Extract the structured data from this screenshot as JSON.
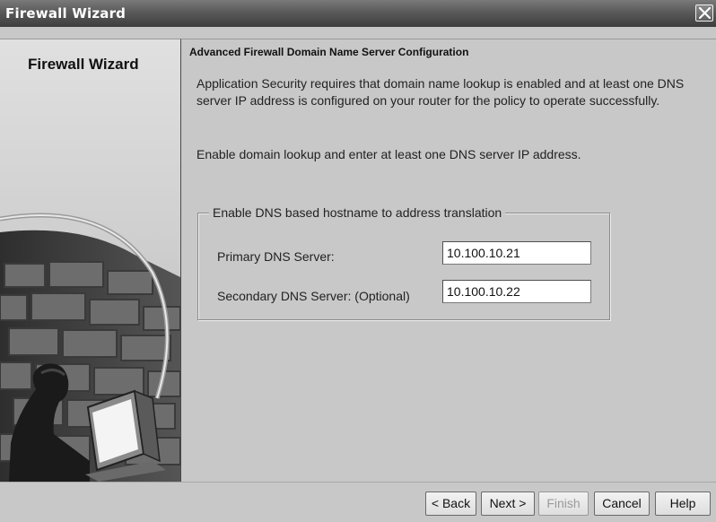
{
  "window": {
    "title": "Firewall Wizard",
    "close_icon": "close-icon"
  },
  "left_panel": {
    "title": "Firewall Wizard"
  },
  "content": {
    "heading": "Advanced Firewall Domain Name Server Configuration",
    "description": "Application Security requires that domain name lookup is enabled and at least one DNS server IP address is configured on your router for the policy to operate successfully.",
    "instruction": "Enable domain lookup and enter at least one DNS server IP address.",
    "group": {
      "legend": "Enable DNS based hostname to address translation",
      "primary_label": "Primary DNS Server:",
      "primary_value": "10.100.10.21",
      "secondary_label": "Secondary DNS Server: (Optional)",
      "secondary_value": "10.100.10.22"
    }
  },
  "buttons": {
    "back": "< Back",
    "next": "Next >",
    "finish": "Finish",
    "cancel": "Cancel",
    "help": "Help"
  }
}
